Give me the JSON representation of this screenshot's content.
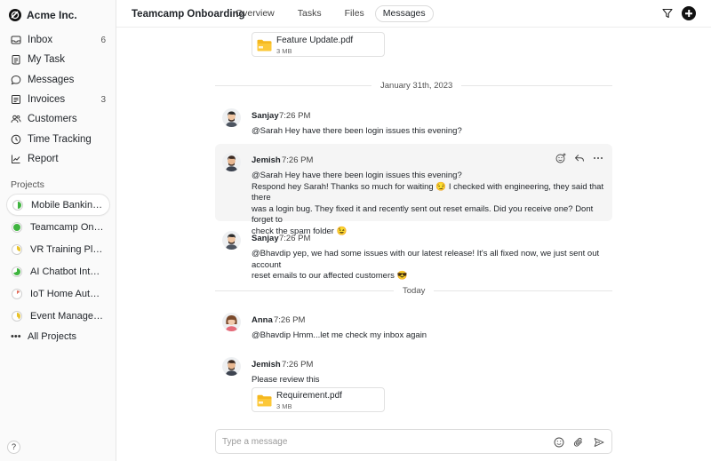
{
  "sidebar": {
    "brand": "Acme Inc.",
    "nav": [
      {
        "label": "Inbox",
        "count": "6",
        "icon": "inbox-icon"
      },
      {
        "label": "My Task",
        "count": "",
        "icon": "clipboard-icon"
      },
      {
        "label": "Messages",
        "count": "",
        "icon": "chat-bubble-icon"
      },
      {
        "label": "Invoices",
        "count": "3",
        "icon": "invoice-icon"
      },
      {
        "label": "Customers",
        "count": "",
        "icon": "users-icon"
      },
      {
        "label": "Time Tracking",
        "count": "",
        "icon": "clock-icon"
      },
      {
        "label": "Report",
        "count": "",
        "icon": "chart-line-icon"
      }
    ],
    "projects_title": "Projects",
    "projects": [
      {
        "label": "Mobile Banking App",
        "color": "#3fb43f",
        "progress": 0.5
      },
      {
        "label": "Teamcamp Onboarding",
        "color": "#3fb43f",
        "progress": 1.0
      },
      {
        "label": "VR Training Platform",
        "color": "#e8c22b",
        "progress": 0.35
      },
      {
        "label": "AI Chatbot Integration",
        "color": "#3fb43f",
        "progress": 0.7
      },
      {
        "label": "IoT Home Automation",
        "color": "#e26d5c",
        "progress": 0.15
      },
      {
        "label": "Event Management",
        "color": "#e8c22b",
        "progress": 0.4
      }
    ],
    "all_projects": "All Projects",
    "help": "?"
  },
  "header": {
    "title": "Teamcamp Onboarding",
    "tabs": [
      "Overview",
      "Tasks",
      "Files",
      "Messages"
    ],
    "active_tab": "Messages"
  },
  "chat": {
    "top_attachment": {
      "name": "Feature Update.pdf",
      "size": "3 MB"
    },
    "date_1": "January 31th, 2023",
    "date_2": "Today",
    "messages": [
      {
        "author": "Sanjay",
        "time": "7:26 PM",
        "lines": [
          "@Sarah Hey have there been login issues this evening?"
        ]
      },
      {
        "author": "Jemish",
        "time": "7:26 PM",
        "lines": [
          "@Sarah Hey have there been login issues this evening?",
          "Respond hey Sarah! Thanks so much for waiting 😏 I checked with engineering, they said that there",
          "was a login bug. They fixed it and recently sent out reset emails. Did you receive one? Dont forget to",
          "check the spam folder 😉"
        ]
      },
      {
        "author": "Sanjay",
        "time": "7:26 PM",
        "lines": [
          "@Bhavdip yep, we had some issues with our latest release! It's all fixed now, we just sent out account",
          "reset emails to our affected customers 😎"
        ]
      },
      {
        "author": "Anna",
        "time": "7:26 PM",
        "lines": [
          "@Bhavdip Hmm...let me check my inbox again"
        ]
      },
      {
        "author": "Jemish",
        "time": "7:26 PM",
        "lines": [
          "Please review this"
        ]
      }
    ],
    "bottom_attachment": {
      "name": "Requirement.pdf",
      "size": "3 MB"
    }
  },
  "composer": {
    "placeholder": "Type a message"
  }
}
